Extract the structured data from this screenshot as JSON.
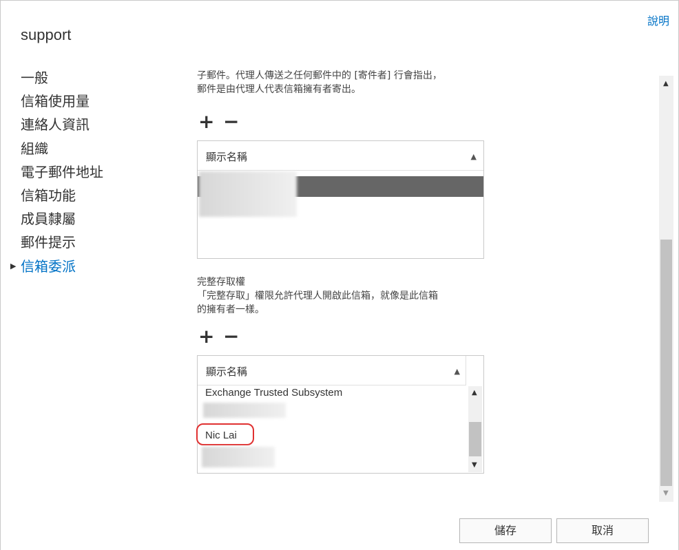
{
  "header": {
    "title": "support",
    "help_label": "說明"
  },
  "nav": {
    "items": [
      {
        "label": "一般"
      },
      {
        "label": "信箱使用量"
      },
      {
        "label": "連絡人資訊"
      },
      {
        "label": "組織"
      },
      {
        "label": "電子郵件地址"
      },
      {
        "label": "信箱功能"
      },
      {
        "label": "成員隸屬"
      },
      {
        "label": "郵件提示"
      },
      {
        "label": "信箱委派",
        "selected": true
      }
    ]
  },
  "send_as": {
    "description_line1": "子郵件。代理人傳送之任何郵件中的 [寄件者] 行會指出，",
    "description_line2": "郵件是由代理人代表信箱擁有者寄出。",
    "add_label": "+",
    "remove_label": "−",
    "column_header": "顯示名稱"
  },
  "full_access": {
    "heading": "完整存取權",
    "description_line1": "「完整存取」權限允許代理人開啟此信箱，就像是此信箱",
    "description_line2": "的擁有者一樣。",
    "add_label": "+",
    "remove_label": "−",
    "column_header": "顯示名稱",
    "rows": [
      {
        "name": "Exchange Trusted Subsystem"
      },
      {
        "name": "Nic Lai",
        "highlighted": true
      }
    ]
  },
  "footer": {
    "save_label": "儲存",
    "cancel_label": "取消"
  },
  "colors": {
    "accent": "#0072c6",
    "highlight": "#e03030",
    "selection": "#666666"
  },
  "icons": {
    "add": "plus-icon",
    "remove": "minus-icon",
    "sort": "sort-ascending-icon",
    "scroll_up": "arrow-up-icon",
    "scroll_down": "arrow-down-icon"
  }
}
